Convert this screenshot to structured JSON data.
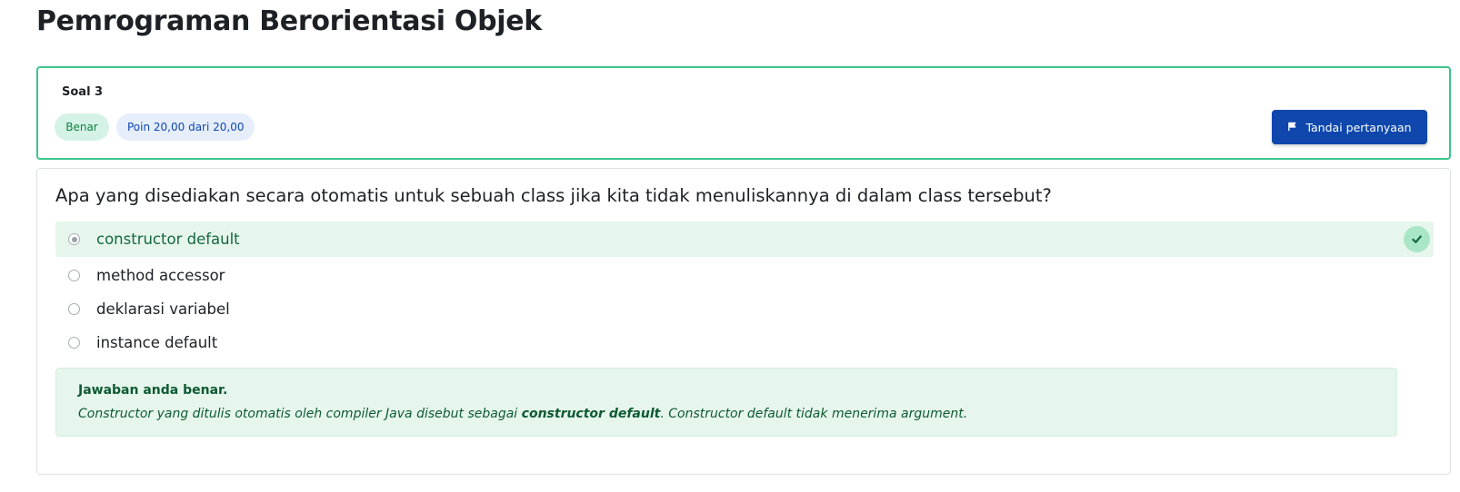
{
  "page": {
    "title": "Pemrograman Berorientasi Objek"
  },
  "question_info": {
    "number_label": "Soal 3",
    "state": "Benar",
    "grade": "Poin 20,00 dari 20,00",
    "flag_label": "Tandai pertanyaan",
    "flag_icon": "flag-icon"
  },
  "question": {
    "text": "Apa yang disediakan secara otomatis untuk sebuah class jika kita tidak menuliskannya di dalam class tersebut?",
    "answers": [
      {
        "label": "constructor default",
        "selected": true,
        "correct": true
      },
      {
        "label": "method accessor",
        "selected": false,
        "correct": false
      },
      {
        "label": "deklarasi variabel",
        "selected": false,
        "correct": false
      },
      {
        "label": "instance default",
        "selected": false,
        "correct": false
      }
    ],
    "correct_icon": "check-icon"
  },
  "feedback": {
    "title": "Jawaban anda benar.",
    "text_before": "Constructor yang ditulis otomatis oleh compiler Java disebut sebagai ",
    "text_bold": "constructor default",
    "text_after": ". Constructor default tidak menerima argument."
  },
  "colors": {
    "accent": "#0f47ad",
    "correct_border": "#3bc58a",
    "correct_bg": "#e6f6ec",
    "correct_text": "#14683f"
  }
}
